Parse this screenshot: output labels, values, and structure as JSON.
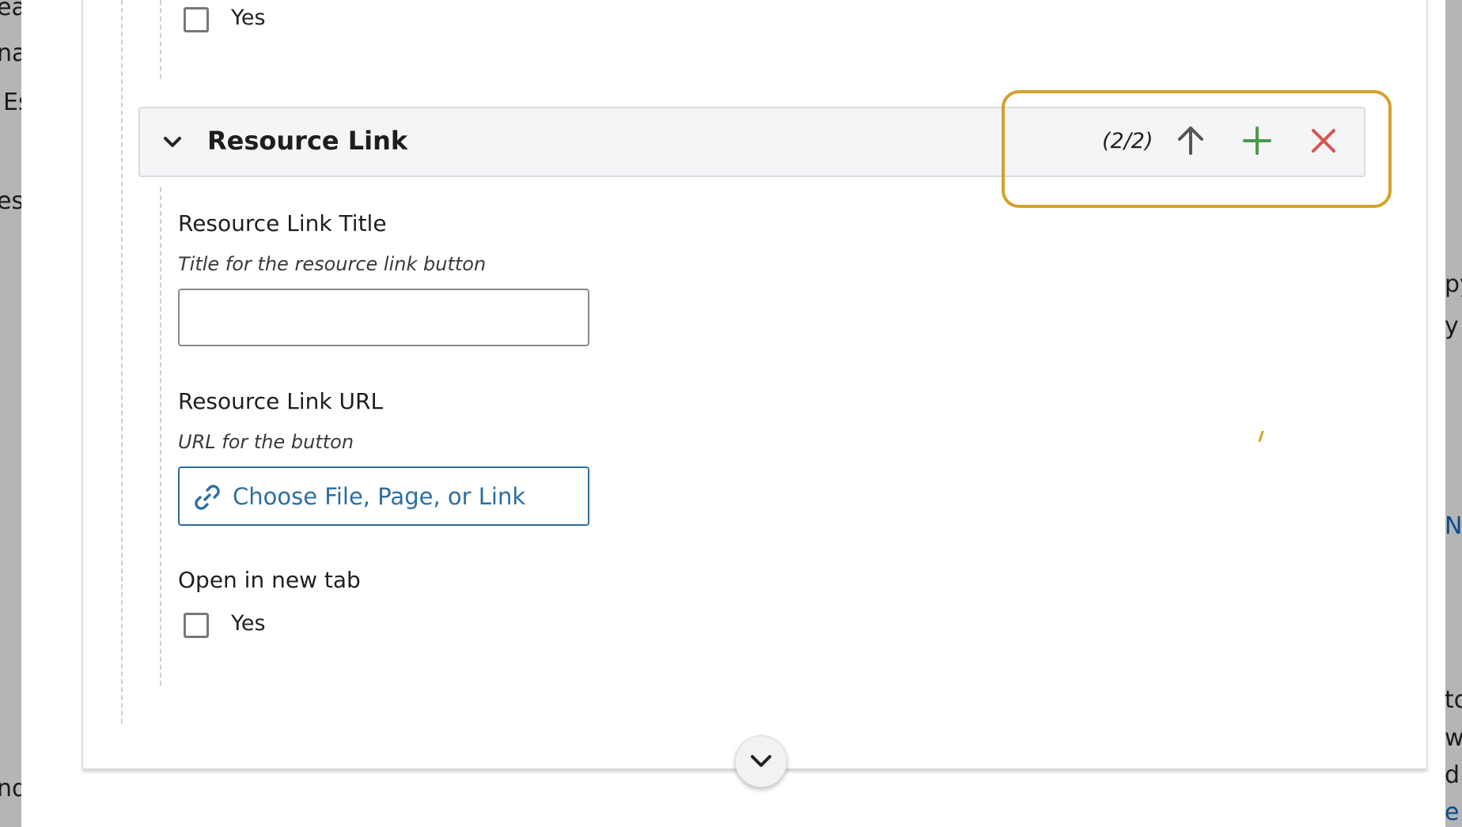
{
  "background": {
    "fragments": [
      "ea",
      "na",
      "Es",
      "es",
      "nd",
      "py",
      "y",
      "N",
      "to",
      "w",
      "d",
      "e"
    ]
  },
  "previous_item": {
    "open_new_tab_option": "Yes"
  },
  "item": {
    "title": "Resource Link",
    "count": "(2/2)",
    "icons": [
      "chevron-down-icon",
      "arrow-up-icon",
      "plus-icon",
      "close-icon"
    ],
    "fields": {
      "title_label": "Resource Link Title",
      "title_help": "Title for the resource link button",
      "title_value": "",
      "url_label": "Resource Link URL",
      "url_help": "URL for the button",
      "url_button_label": "Choose File, Page, or Link",
      "new_tab_label": "Open in new tab",
      "new_tab_option": "Yes"
    }
  },
  "colors": {
    "highlight": "#d4a22a",
    "add": "#4a9a4a",
    "remove": "#d9534f",
    "link": "#2d6ea3"
  }
}
